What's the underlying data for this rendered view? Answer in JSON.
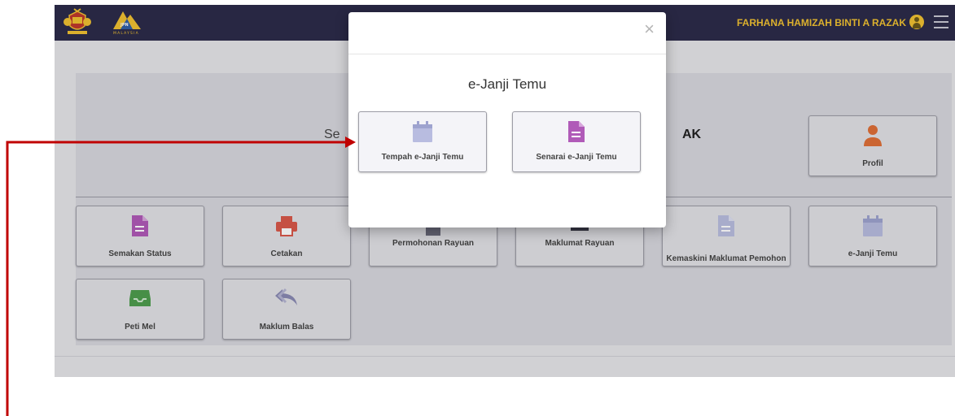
{
  "header": {
    "user_name": "FARHANA HAMIZAH BINTI A RAZAK",
    "logo_text": "MALAYSIA"
  },
  "welcome": {
    "text_left": "Se",
    "text_right": "AK"
  },
  "tiles": {
    "profil": "Profil",
    "semakan_status": "Semakan Status",
    "cetakan": "Cetakan",
    "permohonan_rayuan": "Permohonan Rayuan",
    "maklumat_rayuan": "Maklumat Rayuan",
    "kemaskini": "Kemaskini Maklumat Pemohon",
    "ejanji_temu": "e-Janji Temu",
    "peti_mel": "Peti Mel",
    "maklum_balas": "Maklum Balas"
  },
  "modal": {
    "close_symbol": "×",
    "title": "e-Janji Temu",
    "btn_tempah": "Tempah e-Janji Temu",
    "btn_senarai": "Senarai e-Janji Temu"
  },
  "colors": {
    "topbar": "#2d2b4a",
    "user_name": "#f1c232",
    "annotation_arrow": "#c00000",
    "profile_icon": "#e07038",
    "document_icon": "#b05ab8",
    "calendar_icon": "#b8bce0",
    "printer_icon": "#d9584a",
    "inbox_icon": "#4f9e4f",
    "reply_icon": "#8a8ab4"
  }
}
